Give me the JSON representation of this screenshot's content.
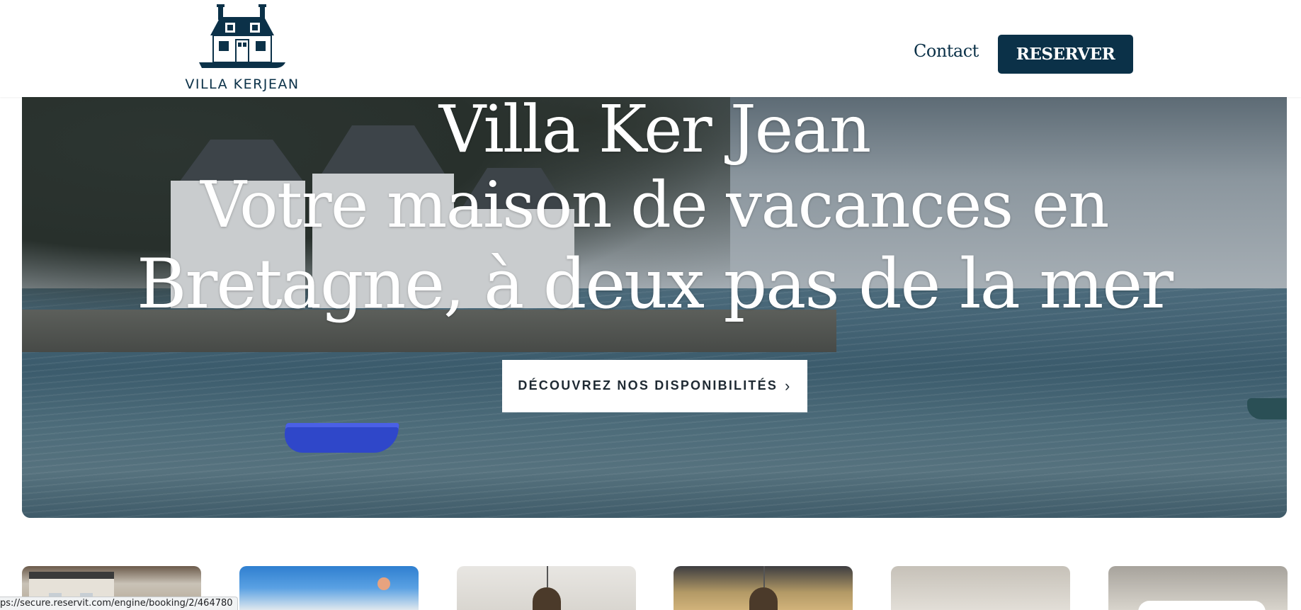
{
  "header": {
    "logo_text": "VILLA KERJEAN",
    "contact_label": "Contact",
    "reserve_label": "RESERVER"
  },
  "hero": {
    "title_line1": "Villa Ker Jean",
    "title_line2": "Votre maison de vacances en",
    "title_line3": "Bretagne, à deux pas de la mer",
    "cta_label": "DÉCOUVREZ NOS DISPONIBILITÉS"
  },
  "gallery": {
    "thumbnails": [
      "house-exterior",
      "sky-flowers",
      "interior-lamp",
      "interior-lamp-warm",
      "interior-room",
      "interior-light"
    ]
  },
  "status_bar": {
    "url": "ps://secure.reservit.com/engine/booking/2/464780"
  },
  "colors": {
    "brand_navy": "#0b3148",
    "white": "#ffffff"
  }
}
